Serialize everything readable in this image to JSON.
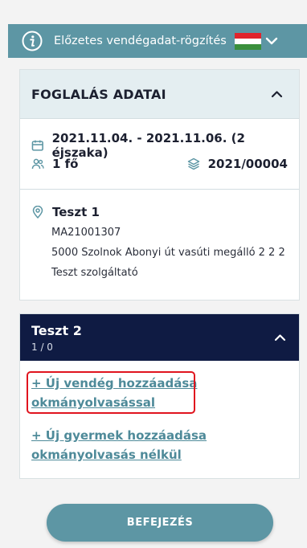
{
  "header": {
    "title": "Előzetes vendégadat-rögzítés",
    "language_flag": "hungarian-flag",
    "colors": {
      "bar": "#5d96a4"
    }
  },
  "booking": {
    "title": "FOGLALÁS ADATAI",
    "dates": "2021.11.04. - 2021.11.06. (2 éjszaka)",
    "guests": "1 fő",
    "booking_number": "2021/00004",
    "location": {
      "name": "Teszt 1",
      "code": "MA21001307",
      "address": "5000 Szolnok Abonyi út vasúti megálló 2 2 2",
      "provider": "Teszt szolgáltató"
    }
  },
  "guest_section": {
    "name": "Teszt 2",
    "count": "1 / 0",
    "add_guest_with_scan_line1": "+ Új vendég hozzáadása",
    "add_guest_with_scan_line2": "okmányolvasással",
    "add_child_without_scan_line1": "+ Új gyermek hozzáadása",
    "add_child_without_scan_line2": "okmányolvasás nélkül",
    "colors": {
      "header": "#0f1b43",
      "link": "#4e8a99",
      "highlight": "#e0141e"
    }
  },
  "finish_button": "BEFEJEZÉS"
}
